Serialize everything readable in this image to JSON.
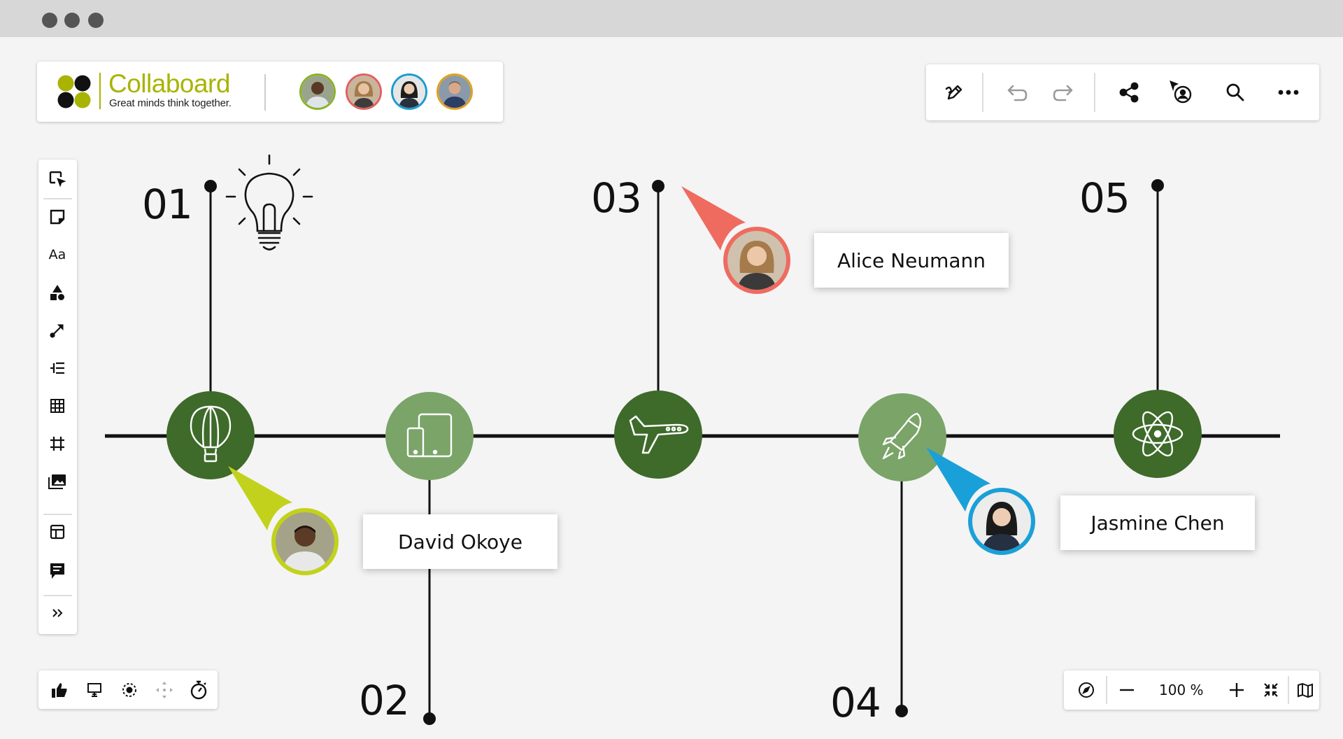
{
  "window": {
    "controls": [
      "window-dot-1",
      "window-dot-2",
      "window-dot-3"
    ]
  },
  "brand": {
    "name": "Collaboard",
    "tagline": "Great minds think together."
  },
  "collaborators": [
    {
      "ring": "#8bb326",
      "name": "collaborator-1"
    },
    {
      "ring": "#e06060",
      "name": "collaborator-2"
    },
    {
      "ring": "#1a9bd0",
      "name": "collaborator-3"
    },
    {
      "ring": "#e0a020",
      "name": "collaborator-4"
    }
  ],
  "toolbar": {
    "icons": [
      "edit-icon",
      "undo-icon",
      "redo-icon",
      "share-icon",
      "follow-presenter-icon",
      "search-icon",
      "more-icon"
    ]
  },
  "left_tools": [
    "select-tool-icon",
    "sticky-note-icon",
    "text-tool-icon",
    "shapes-icon",
    "connector-icon",
    "mindmap-icon",
    "table-icon",
    "frame-icon",
    "media-icon",
    "template-icon",
    "comment-icon",
    "expand-icon"
  ],
  "left_text_tool_label": "Aa",
  "bottom_tools": [
    "like-icon",
    "presentation-icon",
    "target-icon",
    "move-icon",
    "timer-icon"
  ],
  "zoom": {
    "level": "100 %"
  },
  "timeline": {
    "steps": [
      {
        "number": "01",
        "icon": "balloon-icon",
        "tone": "dark"
      },
      {
        "number": "02",
        "icon": "devices-icon",
        "tone": "light"
      },
      {
        "number": "03",
        "icon": "airplane-icon",
        "tone": "dark"
      },
      {
        "number": "04",
        "icon": "rocket-icon",
        "tone": "light"
      },
      {
        "number": "05",
        "icon": "atom-icon",
        "tone": "dark"
      }
    ],
    "colors": {
      "dark": "#3e6a2a",
      "light": "#7aa468",
      "line": "#111111"
    }
  },
  "cursors": [
    {
      "name": "David Okoye",
      "color": "#c2d21c"
    },
    {
      "name": "Alice Neumann",
      "color": "#ef6b60"
    },
    {
      "name": "Jasmine Chen",
      "color": "#1aa0d8"
    }
  ],
  "decoration": {
    "icon": "lightbulb-icon"
  }
}
